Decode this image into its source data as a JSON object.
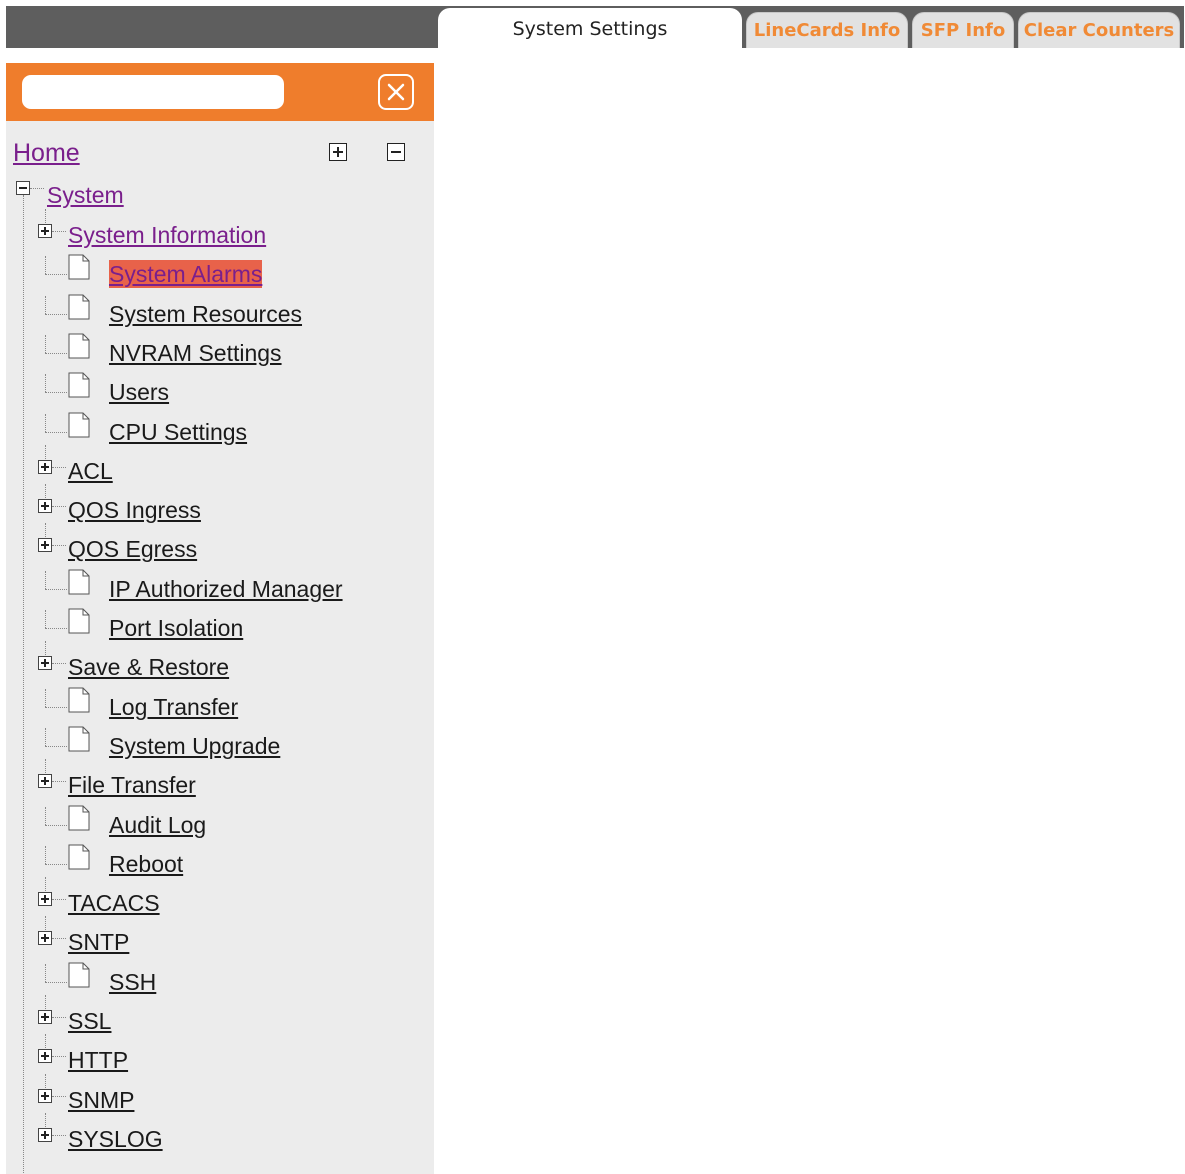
{
  "tabs": [
    {
      "label": "System Settings",
      "active": true
    },
    {
      "label": "LineCards Info",
      "active": false
    },
    {
      "label": "SFP Info",
      "active": false
    },
    {
      "label": "Clear Counters",
      "active": false
    }
  ],
  "search": {
    "value": "",
    "placeholder": ""
  },
  "colors": {
    "accent": "#ef7d2c",
    "tab_text_inactive": "#f08a36",
    "selected_bg": "#e8624a",
    "visited_link": "#7a1f8c",
    "topbar": "#5e5e5e",
    "sidebar_bg": "#ececec"
  },
  "tree": {
    "home": "Home",
    "root": "System",
    "items": [
      {
        "label": "System Information",
        "type": "folder",
        "state": "collapsed",
        "visited": true
      },
      {
        "label": "System Alarms",
        "type": "page",
        "selected": true
      },
      {
        "label": "System Resources",
        "type": "page"
      },
      {
        "label": "NVRAM Settings",
        "type": "page"
      },
      {
        "label": "Users",
        "type": "page"
      },
      {
        "label": "CPU Settings",
        "type": "page"
      },
      {
        "label": "ACL",
        "type": "folder",
        "state": "collapsed"
      },
      {
        "label": "QOS Ingress",
        "type": "folder",
        "state": "collapsed"
      },
      {
        "label": "QOS Egress",
        "type": "folder",
        "state": "collapsed"
      },
      {
        "label": "IP Authorized Manager",
        "type": "page"
      },
      {
        "label": "Port Isolation",
        "type": "page"
      },
      {
        "label": "Save & Restore",
        "type": "folder",
        "state": "collapsed"
      },
      {
        "label": "Log Transfer",
        "type": "page"
      },
      {
        "label": "System Upgrade",
        "type": "page"
      },
      {
        "label": "File Transfer",
        "type": "folder",
        "state": "collapsed"
      },
      {
        "label": "Audit Log",
        "type": "page"
      },
      {
        "label": "Reboot",
        "type": "page"
      },
      {
        "label": "TACACS",
        "type": "folder",
        "state": "collapsed"
      },
      {
        "label": "SNTP",
        "type": "folder",
        "state": "collapsed"
      },
      {
        "label": "SSH",
        "type": "page"
      },
      {
        "label": "SSL",
        "type": "folder",
        "state": "collapsed"
      },
      {
        "label": "HTTP",
        "type": "folder",
        "state": "collapsed"
      },
      {
        "label": "SNMP",
        "type": "folder",
        "state": "collapsed"
      },
      {
        "label": "SYSLOG",
        "type": "folder",
        "state": "collapsed"
      }
    ]
  },
  "icons": {
    "close": "close-icon",
    "expand_all": "expand-all-icon",
    "collapse_all": "collapse-all-icon",
    "folder_toggle": "plus-box-icon",
    "page": "document-icon"
  }
}
